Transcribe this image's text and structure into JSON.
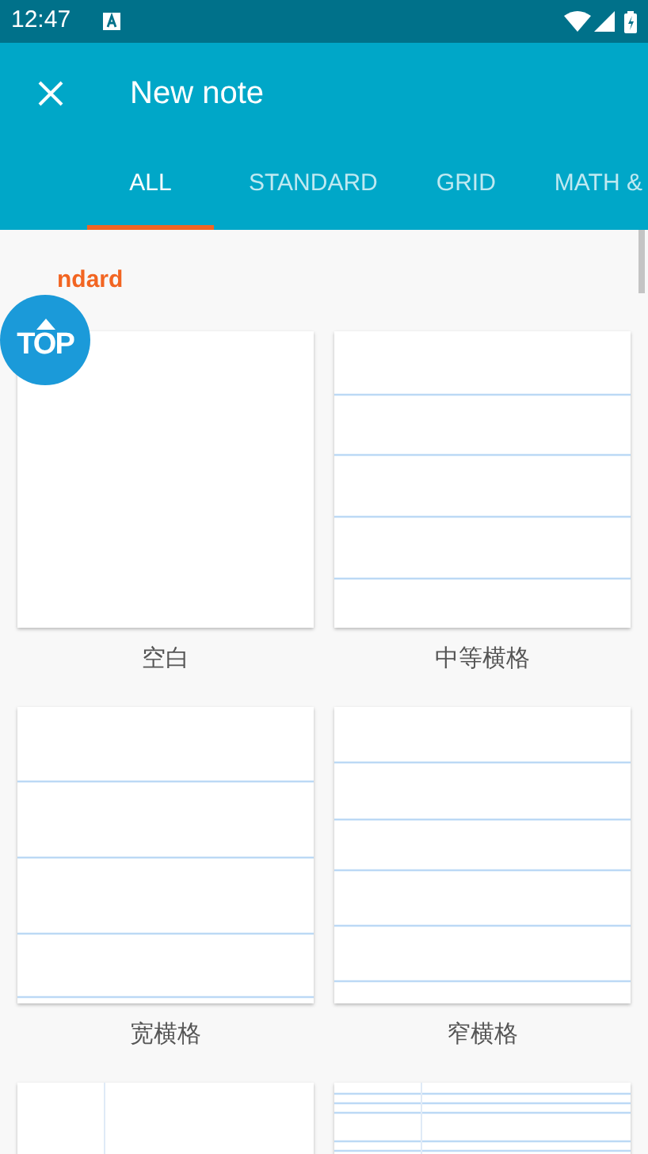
{
  "status_bar": {
    "time": "12:47"
  },
  "app_bar": {
    "title": "New note"
  },
  "tabs": [
    {
      "label": "ALL",
      "selected": true
    },
    {
      "label": "STANDARD",
      "selected": false
    },
    {
      "label": "GRID",
      "selected": false
    },
    {
      "label": "MATH &",
      "selected": false
    }
  ],
  "section": {
    "title": "ndard"
  },
  "scroll_top_button": {
    "label": "TOP"
  },
  "templates": [
    {
      "name": "空白",
      "kind": "blank"
    },
    {
      "name": "中等横格",
      "kind": "medium-ruled"
    },
    {
      "name": "宽横格",
      "kind": "wide-ruled"
    },
    {
      "name": "窄横格",
      "kind": "narrow-ruled"
    },
    {
      "kind": "margin"
    },
    {
      "kind": "ruled-margin"
    }
  ]
}
